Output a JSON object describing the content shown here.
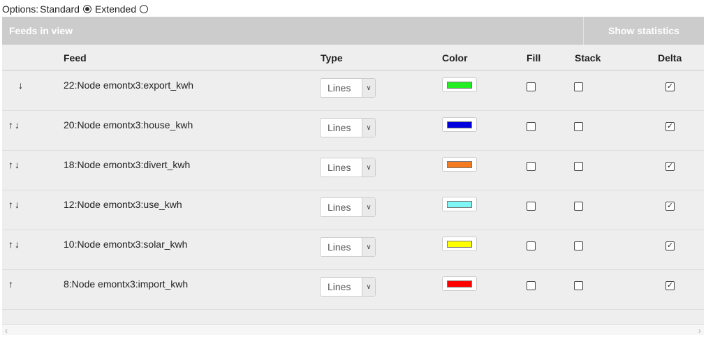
{
  "options": {
    "label": "Options:",
    "standard_label": "Standard",
    "extended_label": "Extended",
    "selected": "Standard"
  },
  "panel": {
    "title": "Feeds in view",
    "stats_button": "Show statistics"
  },
  "table": {
    "headers": {
      "feed": "Feed",
      "type": "Type",
      "color": "Color",
      "fill": "Fill",
      "stack": "Stack",
      "delta": "Delta"
    },
    "arrow_icons": {
      "up": "arrow-up-icon",
      "down": "arrow-down-icon"
    },
    "rows": [
      {
        "feed": "22:Node emontx3:export_kwh",
        "type": "Lines",
        "color": "#22ee22",
        "fill": false,
        "stack": false,
        "delta": true,
        "up": false,
        "down": true
      },
      {
        "feed": "20:Node emontx3:house_kwh",
        "type": "Lines",
        "color": "#0000dd",
        "fill": false,
        "stack": false,
        "delta": true,
        "up": true,
        "down": true
      },
      {
        "feed": "18:Node emontx3:divert_kwh",
        "type": "Lines",
        "color": "#f47b20",
        "fill": false,
        "stack": false,
        "delta": true,
        "up": true,
        "down": true
      },
      {
        "feed": "12:Node emontx3:use_kwh",
        "type": "Lines",
        "color": "#7ff6f6",
        "fill": false,
        "stack": false,
        "delta": true,
        "up": true,
        "down": true
      },
      {
        "feed": "10:Node emontx3:solar_kwh",
        "type": "Lines",
        "color": "#ffff00",
        "fill": false,
        "stack": false,
        "delta": true,
        "up": true,
        "down": true
      },
      {
        "feed": "8:Node emontx3:import_kwh",
        "type": "Lines",
        "color": "#ff0000",
        "fill": false,
        "stack": false,
        "delta": true,
        "up": true,
        "down": false
      }
    ]
  }
}
